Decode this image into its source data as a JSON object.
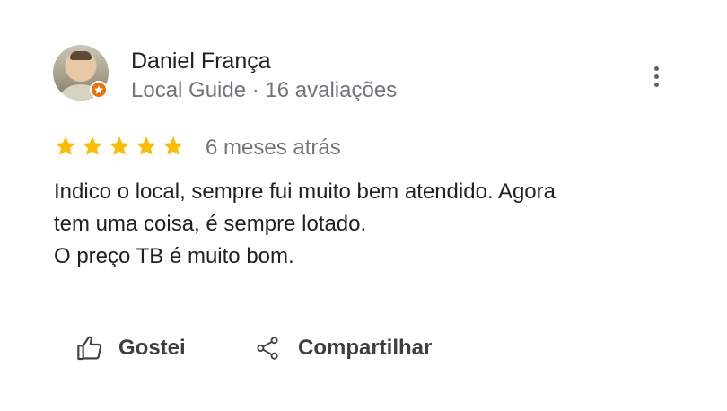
{
  "author": {
    "name": "Daniel França",
    "meta": "Local Guide · 16 avaliações"
  },
  "review": {
    "rating": 5,
    "rating_max": 5,
    "date": "6 meses atrás",
    "lines": [
      "Indico o local, sempre fui muito bem atendido. Agora",
      "tem uma coisa, é sempre lotado.",
      "O preço TB é muito bom."
    ]
  },
  "actions": {
    "like_label": "Gostei",
    "share_label": "Compartilhar"
  },
  "icons": {
    "more": "more-vert-icon",
    "like": "thumb-up-icon",
    "share": "share-icon",
    "star": "star-icon",
    "guide_badge": "local-guide-badge-icon"
  },
  "colors": {
    "star": "#fbbc04",
    "badge": "#e8710a",
    "text_primary": "#202124",
    "text_secondary": "#70757a"
  }
}
